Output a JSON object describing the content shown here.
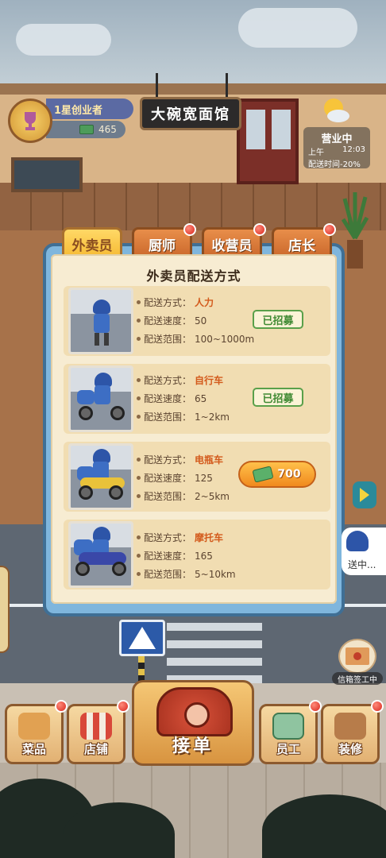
{
  "hud": {
    "level_title": "1星创业者",
    "cash": "465",
    "shop_name": "大碗宽面馆",
    "status_title": "营业中",
    "period": "上午",
    "clock": "12:03",
    "delivery_time": "配送时间-20%"
  },
  "tabs": [
    {
      "label": "外卖员",
      "active": true,
      "badge": false
    },
    {
      "label": "厨师",
      "active": false,
      "badge": true
    },
    {
      "label": "收营员",
      "active": false,
      "badge": true
    },
    {
      "label": "店长",
      "active": false,
      "badge": true
    }
  ],
  "dialog": {
    "title": "外卖员配送方式",
    "field_labels": {
      "method": "配送方式：",
      "speed": "配送速度：",
      "range": "配送范围："
    },
    "options": [
      {
        "method": "人力",
        "speed": "50",
        "range": "100~1000m",
        "state": "已招募"
      },
      {
        "method": "自行车",
        "speed": "65",
        "range": "1~2km",
        "state": "已招募"
      },
      {
        "method": "电瓶车",
        "speed": "125",
        "range": "2~5km",
        "price": "700"
      },
      {
        "method": "摩托车",
        "speed": "165",
        "range": "5~10km"
      }
    ]
  },
  "street": {
    "courier_status": "送中...",
    "letter_label": "信箱签工中"
  },
  "bottom_nav": {
    "menu": "菜品",
    "store": "店铺",
    "take_order": "接单",
    "staff": "员工",
    "decorate": "装修"
  },
  "colors": {
    "accent_orange": "#f08a1e",
    "tab_active": "#f5b932",
    "hired_green": "#3f8a33",
    "value_orange": "#d35a1c"
  }
}
